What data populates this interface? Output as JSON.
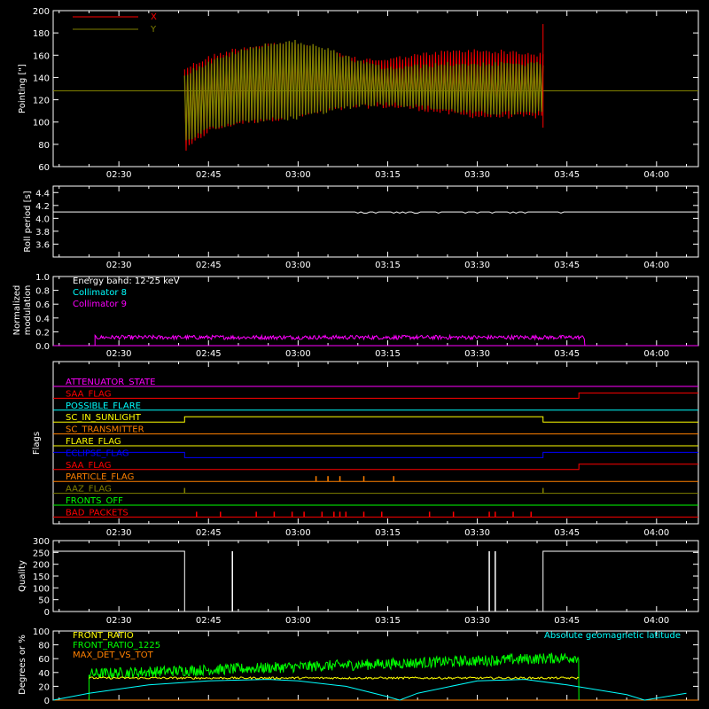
{
  "chart_data": [
    {
      "type": "line",
      "ylabel": "Pointing [\"]",
      "ylim": [
        60,
        200
      ],
      "yticks": [
        60,
        80,
        100,
        120,
        140,
        160,
        180,
        200
      ],
      "series": [
        {
          "name": "X",
          "color": "#ff0000",
          "t_range": [
            "02:41",
            "03:41"
          ],
          "envelope_hi": [
            [
              "02:41",
              150
            ],
            [
              "02:45",
              160
            ],
            [
              "02:50",
              168
            ],
            [
              "02:55",
              172
            ],
            [
              "03:00",
              172
            ],
            [
              "03:05",
              165
            ],
            [
              "03:10",
              158
            ],
            [
              "03:15",
              158
            ],
            [
              "03:20",
              162
            ],
            [
              "03:25",
              165
            ],
            [
              "03:30",
              166
            ],
            [
              "03:35",
              165
            ],
            [
              "03:41",
              162
            ]
          ],
          "envelope_lo": [
            [
              "02:41",
              72
            ],
            [
              "02:45",
              90
            ],
            [
              "02:50",
              97
            ],
            [
              "02:55",
              100
            ],
            [
              "03:00",
              103
            ],
            [
              "03:05",
              108
            ],
            [
              "03:10",
              112
            ],
            [
              "03:15",
              112
            ],
            [
              "03:20",
              110
            ],
            [
              "03:25",
              106
            ],
            [
              "03:30",
              103
            ],
            [
              "03:35",
              103
            ],
            [
              "03:41",
              103
            ]
          ]
        },
        {
          "name": "Y",
          "color": "#808000",
          "baseline": 128,
          "envelope_hi": [
            [
              "02:41",
              145
            ],
            [
              "02:45",
              155
            ],
            [
              "02:50",
              165
            ],
            [
              "02:55",
              172
            ],
            [
              "03:00",
              174
            ],
            [
              "03:05",
              167
            ],
            [
              "03:10",
              156
            ],
            [
              "03:15",
              150
            ],
            [
              "03:20",
              152
            ],
            [
              "03:25",
              154
            ],
            [
              "03:30",
              154
            ],
            [
              "03:35",
              154
            ],
            [
              "03:41",
              154
            ]
          ],
          "envelope_lo": [
            [
              "02:41",
              80
            ],
            [
              "02:45",
              92
            ],
            [
              "02:50",
              98
            ],
            [
              "02:55",
              100
            ],
            [
              "03:00",
              102
            ],
            [
              "03:05",
              108
            ],
            [
              "03:10",
              113
            ],
            [
              "03:15",
              115
            ],
            [
              "03:20",
              112
            ],
            [
              "03:25",
              109
            ],
            [
              "03:30",
              106
            ],
            [
              "03:35",
              106
            ],
            [
              "03:41",
              106
            ]
          ]
        }
      ]
    },
    {
      "type": "line",
      "ylabel": "Roll period [s]",
      "ylim": [
        3.4,
        4.5
      ],
      "yticks": [
        3.6,
        3.8,
        4.0,
        4.2,
        4.4
      ],
      "series": [
        {
          "name": "",
          "color": "#ffffff",
          "value": 4.1,
          "t_range": [
            "02:19",
            "04:07"
          ]
        }
      ]
    },
    {
      "type": "line",
      "ylabel": "Normalized modulation",
      "ylim": [
        0,
        1
      ],
      "yticks": [
        0.0,
        0.2,
        0.4,
        0.6,
        0.8,
        1.0
      ],
      "annotation": "Energy band: 12-25 keV",
      "series": [
        {
          "name": "Collimator 8",
          "color": "#00ffff",
          "value": 0
        },
        {
          "name": "Collimator 9",
          "color": "#ff00ff",
          "value": 0.12,
          "t_range": [
            "02:26",
            "03:48"
          ]
        }
      ]
    },
    {
      "type": "line",
      "ylabel": "Flags",
      "series": [
        {
          "name": "ATTENUATOR_STATE",
          "color": "#ff00ff",
          "steps": []
        },
        {
          "name": "SAA_FLAG",
          "color": "#ff0000",
          "steps": [
            [
              "03:47",
              1
            ]
          ]
        },
        {
          "name": "POSSIBLE_FLARE",
          "color": "#00ffff",
          "steps": []
        },
        {
          "name": "SC_IN_SUNLIGHT",
          "color": "#ffff00",
          "steps": [
            [
              "02:41",
              1
            ],
            [
              "03:41",
              0
            ]
          ]
        },
        {
          "name": "SC_TRANSMITTER",
          "color": "#ff8000",
          "steps": []
        },
        {
          "name": "FLARE_FLAG",
          "color": "#ffff00",
          "steps": []
        },
        {
          "name": "ECLIPSE_FLAG",
          "color": "#0000ff",
          "steps": [
            [
              "02:41",
              0
            ],
            [
              "03:41",
              1
            ]
          ]
        },
        {
          "name": "SAA_FLAG",
          "color": "#ff0000",
          "steps": [
            [
              "03:47",
              1
            ]
          ]
        },
        {
          "name": "PARTICLE_FLAG",
          "color": "#ff8000",
          "spikes": [
            "03:03",
            "03:05",
            "03:07",
            "03:11",
            "03:16"
          ]
        },
        {
          "name": "AAZ_FLAG",
          "color": "#808000",
          "spikes": [
            "02:41",
            "03:41"
          ]
        },
        {
          "name": "FRONTS_OFF",
          "color": "#00ff00",
          "steps": []
        },
        {
          "name": "BAD_PACKETS",
          "color": "#ff0000",
          "spikes": [
            "02:43",
            "02:47",
            "02:53",
            "02:56",
            "02:59",
            "03:01",
            "03:04",
            "03:06",
            "03:07",
            "03:08",
            "03:11",
            "03:14",
            "03:22",
            "03:26",
            "03:32",
            "03:33",
            "03:36",
            "03:39"
          ]
        }
      ]
    },
    {
      "type": "line",
      "ylabel": "Quality",
      "ylim": [
        0,
        300
      ],
      "yticks": [
        0,
        50,
        100,
        150,
        200,
        250,
        300
      ],
      "series": [
        {
          "name": "",
          "color": "#ffffff",
          "segments": [
            [
              "02:19",
              "02:41",
              255
            ],
            [
              "02:41",
              "03:41",
              0
            ],
            [
              "03:41",
              "04:07",
              255
            ]
          ],
          "spikes": [
            [
              "02:49",
              255
            ],
            [
              "03:32",
              255
            ],
            [
              "03:33",
              255
            ]
          ]
        }
      ]
    },
    {
      "type": "line",
      "ylabel": "Degrees or %",
      "ylim": [
        0,
        100
      ],
      "yticks": [
        0,
        20,
        40,
        60,
        80,
        100
      ],
      "series": [
        {
          "name": "FRONT_RATIO",
          "color": "#ffff00",
          "value": 32,
          "t_range": [
            "02:25",
            "03:47"
          ]
        },
        {
          "name": "FRONT_RATIO_1225",
          "color": "#00ff00",
          "start": 38,
          "end": 62,
          "t_range": [
            "02:25",
            "03:47"
          ]
        },
        {
          "name": "MAX_DET_VS_TOT",
          "color": "#ff8000",
          "value": 0
        },
        {
          "name": "Absolute geomagnetic latitude",
          "color": "#00ffff",
          "points": [
            [
              "02:19",
              0
            ],
            [
              "02:25",
              10
            ],
            [
              "02:35",
              22
            ],
            [
              "02:45",
              28
            ],
            [
              "02:55",
              30
            ],
            [
              "03:00",
              28
            ],
            [
              "03:08",
              20
            ],
            [
              "03:15",
              5
            ],
            [
              "03:17",
              0
            ],
            [
              "03:20",
              10
            ],
            [
              "03:30",
              28
            ],
            [
              "03:38",
              30
            ],
            [
              "03:45",
              22
            ],
            [
              "03:55",
              8
            ],
            [
              "03:58",
              0
            ],
            [
              "04:05",
              10
            ]
          ]
        }
      ]
    }
  ],
  "time_axis": {
    "tick_labels": [
      "02:30",
      "02:45",
      "03:00",
      "03:15",
      "03:30",
      "03:45",
      "04:00"
    ],
    "range": [
      "02:19",
      "04:07"
    ]
  },
  "legend_text": {
    "p1_x": "X",
    "p1_y": "Y",
    "p3_energy": "Energy band: 12-25 keV",
    "p3_c8": "Collimator 8",
    "p3_c9": "Collimator 9",
    "p6_front_ratio": "FRONT_RATIO",
    "p6_front_ratio_1225": "FRONT_RATIO_1225",
    "p6_max_det": "MAX_DET_VS_TOT",
    "p6_geolat": "Absolute geomagnetic latitude"
  },
  "ylabels": {
    "p1": "Pointing [\"]",
    "p2": "Roll period [s]",
    "p3a": "Normalized",
    "p3b": "modulation",
    "p4": "Flags",
    "p5": "Quality",
    "p6": "Degrees or %"
  }
}
